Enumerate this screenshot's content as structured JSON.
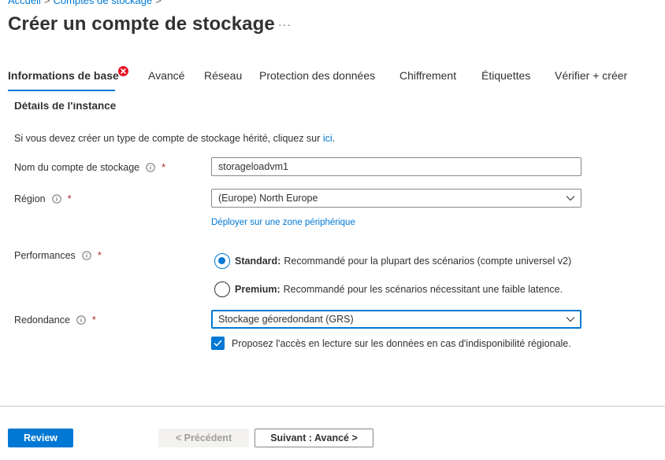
{
  "breadcrumb": {
    "items": [
      "Accueil",
      "Comptes de stockage"
    ],
    "separator": ">"
  },
  "header": {
    "title": "Créer un compte de stockage",
    "more": "···"
  },
  "tabs": [
    {
      "label": "Informations de base",
      "active": true,
      "error": true
    },
    {
      "label": "Avancé"
    },
    {
      "label": "Réseau"
    },
    {
      "label": "Protection des données"
    },
    {
      "label": "Chiffrement"
    },
    {
      "label": "Étiquettes"
    },
    {
      "label": "Vérifier + créer"
    }
  ],
  "section": {
    "heading": "Détails de l'instance",
    "intro_text": "Si vous devez créer un type de compte de stockage hérité, cliquez sur ",
    "intro_link": "ici",
    "intro_end": "."
  },
  "fields": {
    "account_name": {
      "label": "Nom du compte de stockage",
      "required": "*",
      "value": "storageloadvm1"
    },
    "region": {
      "label": "Région",
      "required": "*",
      "value": "(Europe) North Europe",
      "edge_link": "Déployer sur une zone périphérique"
    },
    "performance": {
      "label": "Performances",
      "required": "*",
      "options": [
        {
          "title": "Standard:",
          "desc": "Recommandé pour la plupart des scénarios (compte universel v2)",
          "checked": true
        },
        {
          "title": "Premium:",
          "desc": "Recommandé pour les scénarios nécessitant une faible latence.",
          "checked": false
        }
      ]
    },
    "redundancy": {
      "label": "Redondance",
      "required": "*",
      "value": "Stockage géoredondant (GRS)",
      "read_access_label": "Proposez l'accès en lecture sur les données en cas d'indisponibilité régionale.",
      "read_access_checked": true
    }
  },
  "footer": {
    "review": "Review",
    "previous": "< Précédent",
    "next": "Suivant : Avancé >"
  },
  "colors": {
    "accent": "#0078d4",
    "error": "#e81123",
    "required": "#a4262c",
    "text": "#323130"
  }
}
